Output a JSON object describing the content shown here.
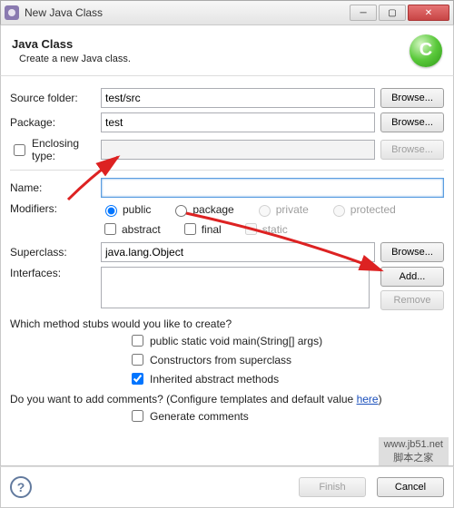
{
  "window": {
    "title": "New Java Class"
  },
  "banner": {
    "heading": "Java Class",
    "desc": "Create a new Java class.",
    "glyph": "C"
  },
  "labels": {
    "source_folder": "Source folder:",
    "package": "Package:",
    "enclosing": "Enclosing type:",
    "name": "Name:",
    "modifiers": "Modifiers:",
    "superclass": "Superclass:",
    "interfaces": "Interfaces:"
  },
  "fields": {
    "source_folder": "test/src",
    "package": "test",
    "enclosing": "",
    "name": "",
    "superclass": "java.lang.Object"
  },
  "buttons": {
    "browse": "Browse...",
    "add": "Add...",
    "remove": "Remove",
    "finish": "Finish",
    "cancel": "Cancel"
  },
  "modifiers": {
    "public": "public",
    "package": "package",
    "private": "private",
    "protected": "protected",
    "abstract": "abstract",
    "final": "final",
    "static": "static"
  },
  "stubs": {
    "question": "Which method stubs would you like to create?",
    "main": "public static void main(String[] args)",
    "constructors": "Constructors from superclass",
    "inherited": "Inherited abstract methods"
  },
  "comments": {
    "question_prefix": "Do you want to add comments? (Configure templates and default value ",
    "here": "here",
    "question_suffix": ")",
    "generate": "Generate comments"
  },
  "watermark": "www.jb51.net\n脚本之家"
}
